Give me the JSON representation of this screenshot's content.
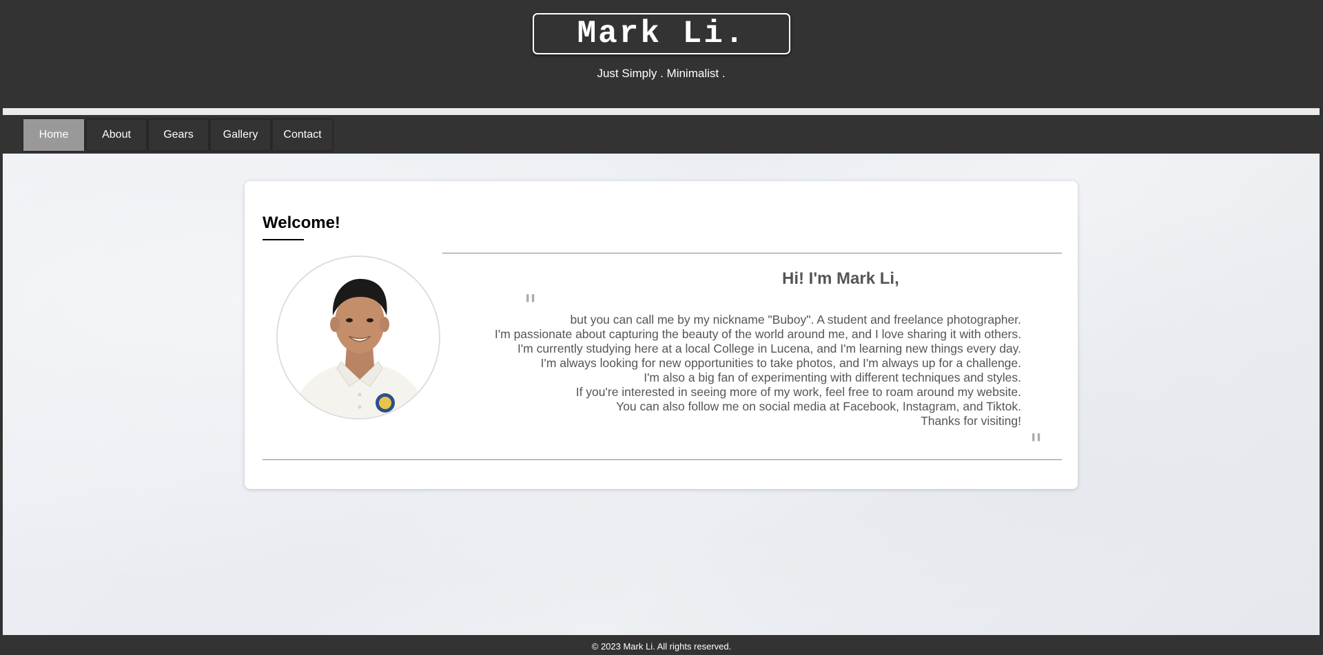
{
  "header": {
    "logo": "Mark Li.",
    "tagline": "Just Simply . Minimalist ."
  },
  "nav": {
    "items": [
      {
        "label": "Home",
        "active": true
      },
      {
        "label": "About",
        "active": false
      },
      {
        "label": "Gears",
        "active": false
      },
      {
        "label": "Gallery",
        "active": false
      },
      {
        "label": "Contact",
        "active": false
      }
    ]
  },
  "card": {
    "heading": "Welcome!",
    "greeting": "Hi! I'm Mark Li,",
    "quote_open": "\"",
    "quote_close": "\"",
    "bio_lines": [
      "but you can call me by my nickname \"Buboy\". A student and freelance photographer.",
      "I'm passionate about capturing the beauty of the world around me, and I love sharing it with others.",
      "I'm currently studying here at a local College in Lucena, and I'm learning new things every day.",
      "I'm always looking for new opportunities to take photos, and I'm always up for a challenge.",
      "I'm also a big fan of experimenting with different techniques and styles.",
      "If you're interested in seeing more of my work, feel free to roam around my website.",
      "You can also follow me on social media at Facebook, Instagram, and Tiktok.",
      "Thanks for visiting!"
    ]
  },
  "footer": {
    "copyright": "© 2023 Mark Li. All rights reserved."
  },
  "colors": {
    "dark": "#333333",
    "active_nav": "#999999",
    "text_gray": "#555555"
  }
}
